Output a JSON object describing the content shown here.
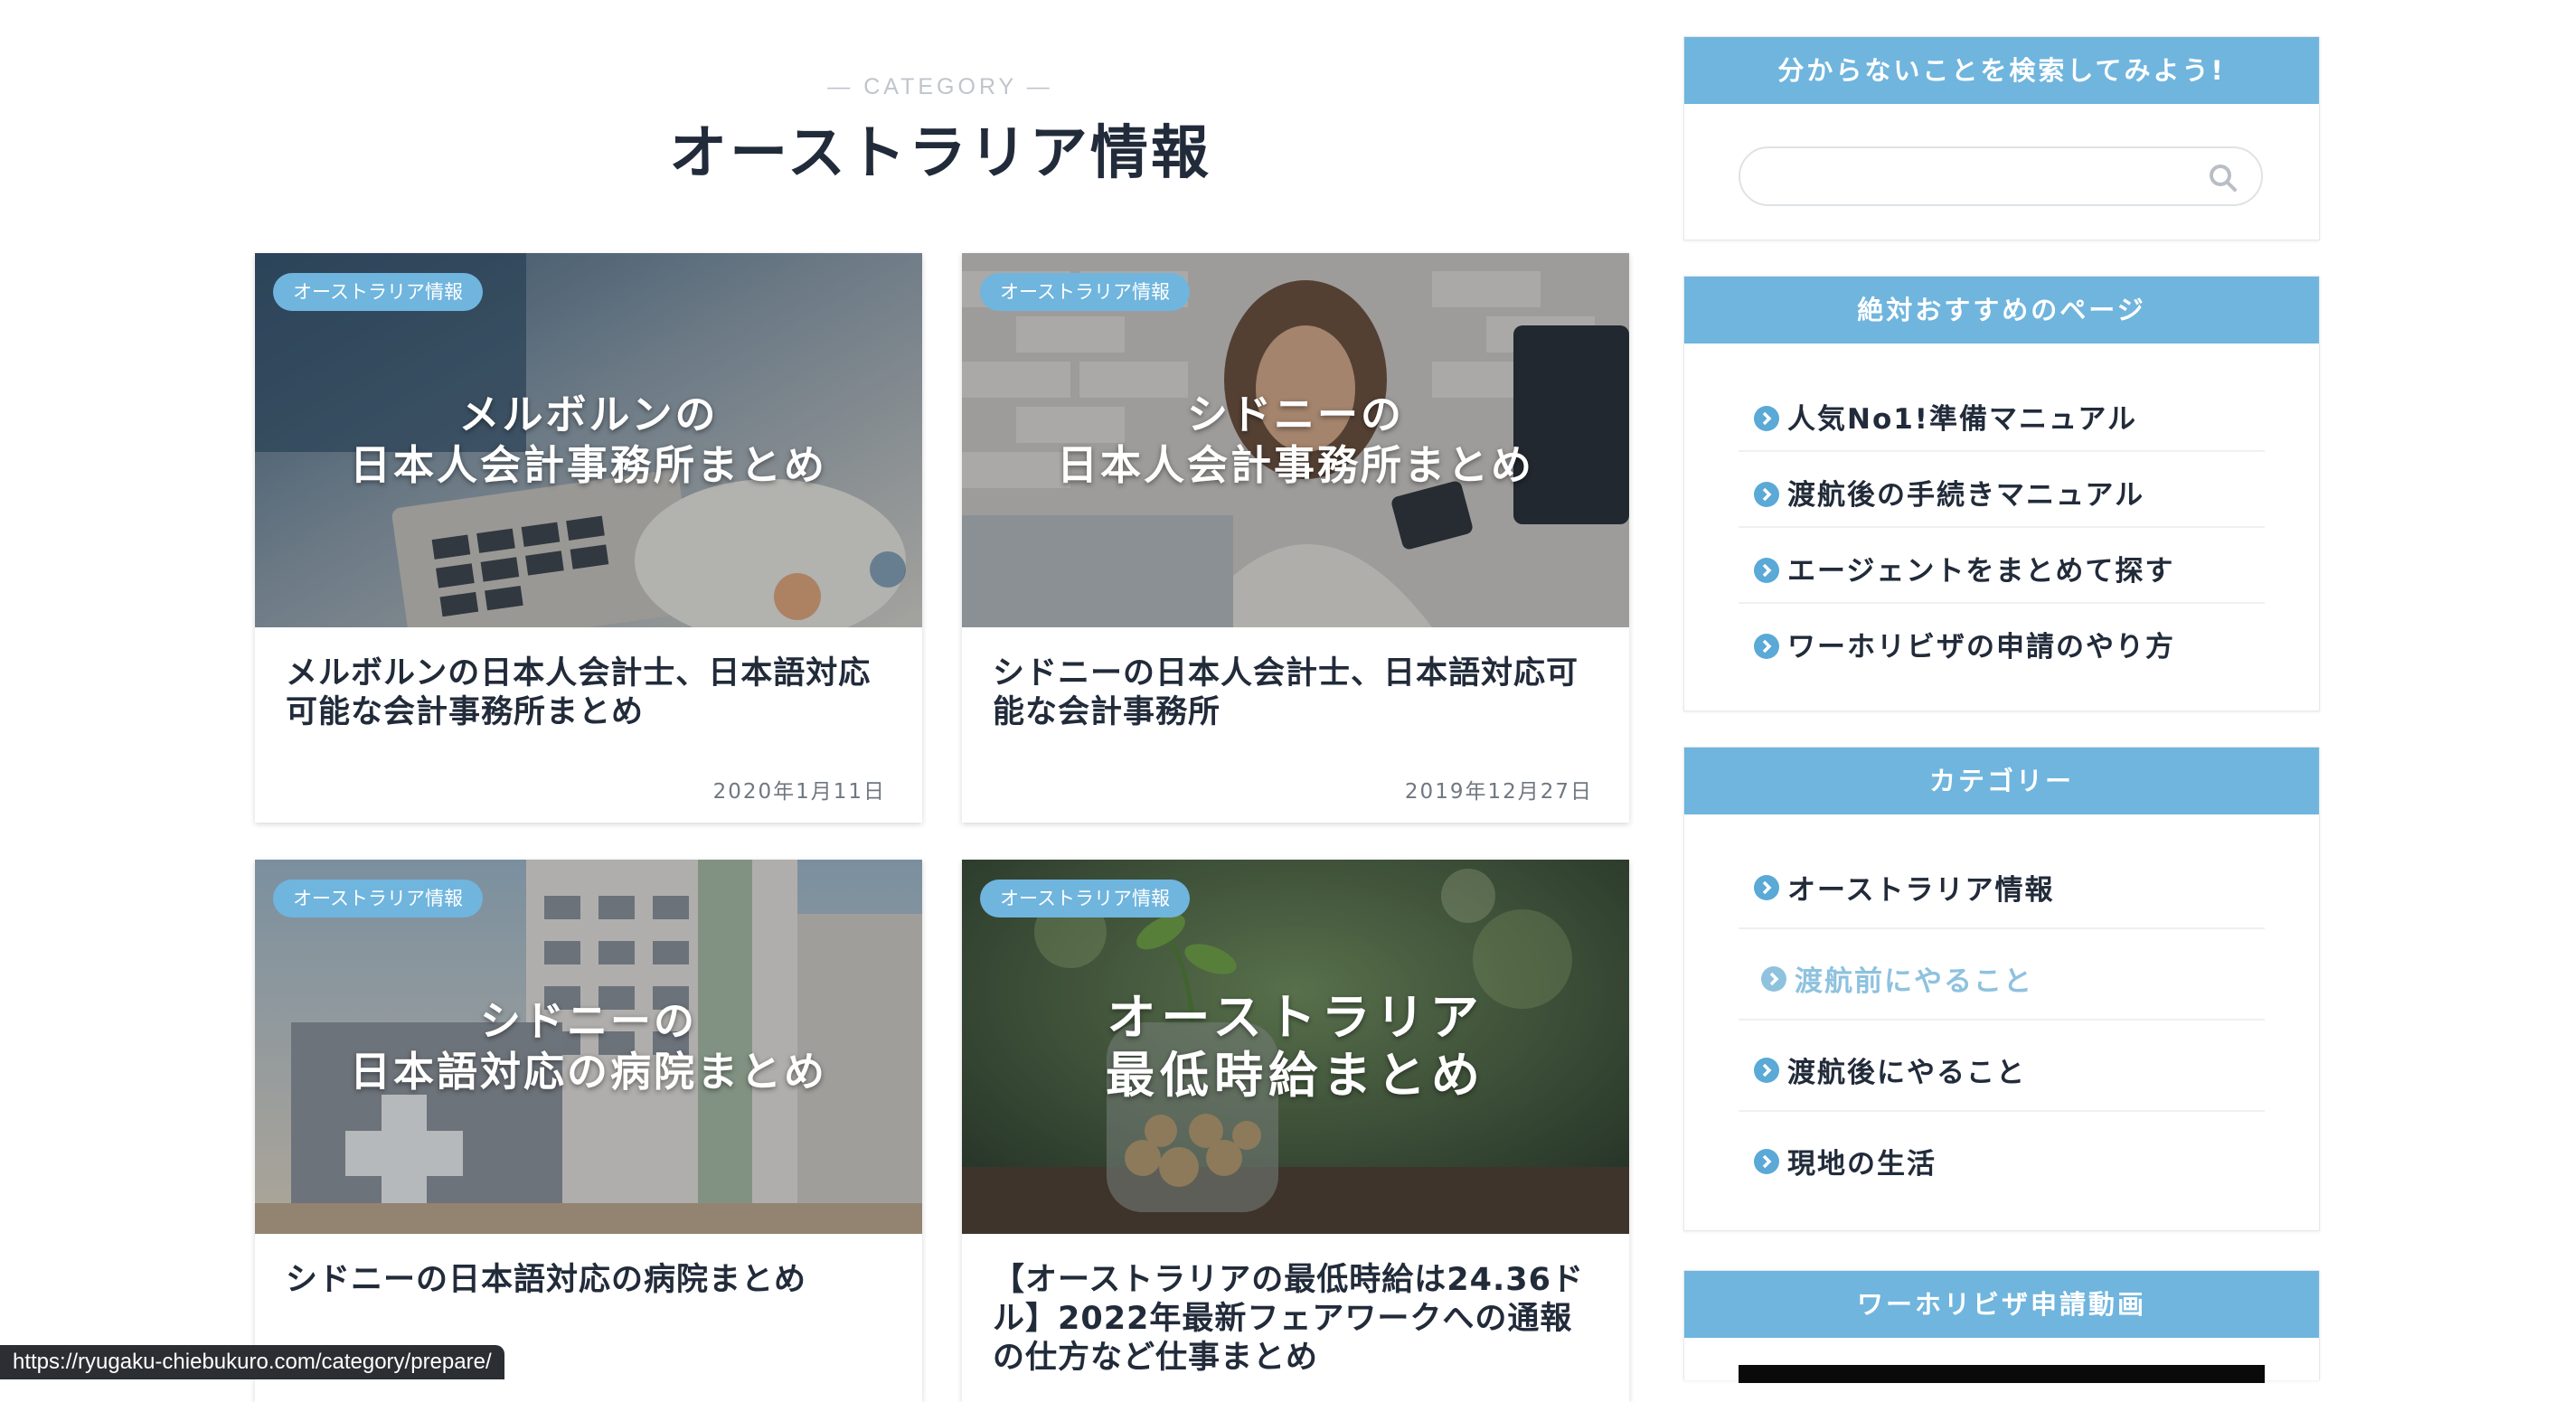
{
  "category_header": {
    "kicker": "— CATEGORY —",
    "title": "オーストラリア情報"
  },
  "posts": [
    {
      "badge": "オーストラリア情報",
      "overlay_line1": "メルボルンの",
      "overlay_line2": "日本人会計事務所まとめ",
      "title": "メルボルンの日本人会計士、日本語対応可能な会計事務所まとめ",
      "date": "2020年1月11日"
    },
    {
      "badge": "オーストラリア情報",
      "overlay_line1": "シドニーの",
      "overlay_line2": "日本人会計事務所まとめ",
      "title": "シドニーの日本人会計士、日本語対応可能な会計事務所",
      "date": "2019年12月27日"
    },
    {
      "badge": "オーストラリア情報",
      "overlay_line1": "シドニーの",
      "overlay_line2": "日本語対応の病院まとめ",
      "title": "シドニーの日本語対応の病院まとめ"
    },
    {
      "badge": "オーストラリア情報",
      "overlay_line1": "オーストラリア",
      "overlay_line2": "最低時給まとめ",
      "title": "【オーストラリアの最低時給は24.36ドル】2022年最新フェアワークへの通報の仕方など仕事まとめ"
    }
  ],
  "sidebar": {
    "search": {
      "heading": "分からないことを検索してみよう!",
      "value": "",
      "icon": "search-icon"
    },
    "recommended": {
      "heading": "絶対おすすめのページ",
      "items": [
        {
          "label": "人気No1!準備マニュアル"
        },
        {
          "label": "渡航後の手続きマニュアル"
        },
        {
          "label": "エージェントをまとめて探す"
        },
        {
          "label": "ワーホリビザの申請のやり方"
        }
      ]
    },
    "categories": {
      "heading": "カテゴリー",
      "items": [
        {
          "label": "オーストラリア情報"
        },
        {
          "label": "渡航前にやること",
          "hovered": true
        },
        {
          "label": "渡航後にやること"
        },
        {
          "label": "現地の生活"
        }
      ]
    },
    "video": {
      "heading": "ワーホリビザ申請動画"
    }
  },
  "status_bar": {
    "url": "https://ryugaku-chiebukuro.com/category/prepare/"
  },
  "colors": {
    "accent": "#6fb5de",
    "text": "#222b3a",
    "muted_link": "#8ec2df"
  }
}
